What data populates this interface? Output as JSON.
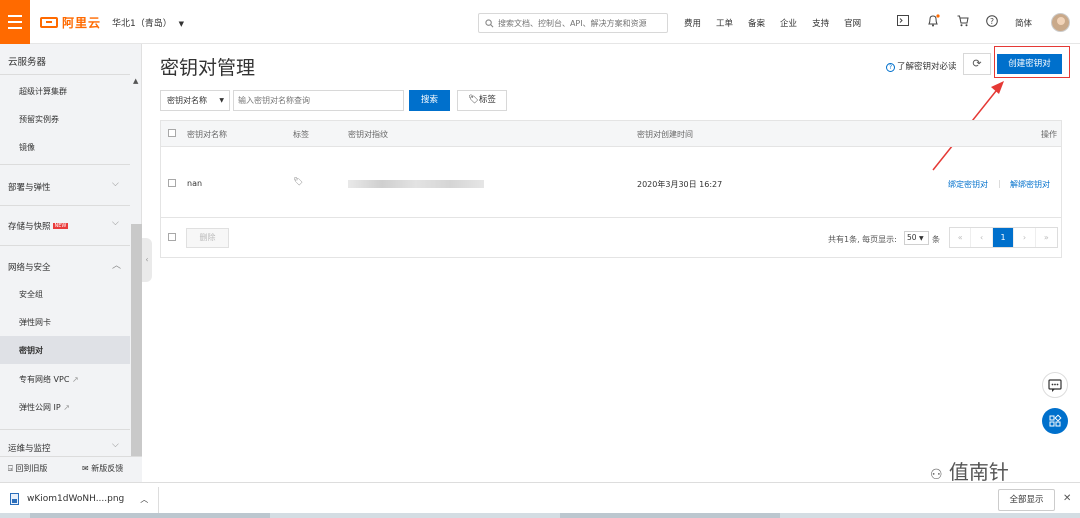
{
  "topbar": {
    "logo_text": "阿里云",
    "region": "华北1（青岛）",
    "search_placeholder": "搜索文档、控制台、API、解决方案和资源",
    "links": [
      "费用",
      "工单",
      "备案",
      "企业",
      "支持",
      "官网"
    ],
    "language": "简体",
    "brand_color": "#ff6a00"
  },
  "sidebar": {
    "title": "云服务器",
    "items_top": [
      "超级计算集群",
      "预留实例券",
      "镜像"
    ],
    "group_deploy": "部署与弹性",
    "group_storage": "存储与快照",
    "new_badge": "NEW",
    "group_network": "网络与安全",
    "network_items": [
      "安全组",
      "弹性网卡",
      "密钥对",
      "专有网络 VPC",
      "弹性公网 IP"
    ],
    "group_ops": "运维与监控",
    "footer_old": "回到旧版",
    "footer_feedback": "新版反馈"
  },
  "page": {
    "title": "密钥对管理",
    "help_link": "了解密钥对必读",
    "create_button": "创建密钥对",
    "accent_color": "#0070cc"
  },
  "filter": {
    "select_value": "密钥对名称",
    "input_placeholder": "输入密钥对名称查询",
    "search_button": "搜索",
    "tag_button": "标签"
  },
  "table": {
    "headers": [
      "密钥对名称",
      "标签",
      "密钥对指纹",
      "密钥对创建时间",
      "操作"
    ],
    "rows": [
      {
        "name": "nan",
        "created": "2020年3月30日 16:27",
        "action_bind": "绑定密钥对",
        "action_unbind": "解绑密钥对"
      }
    ],
    "delete_button": "删除",
    "page_info": "共有1条, 每页显示:",
    "page_size": "50",
    "page_unit": "条",
    "current_page": "1",
    "pager": [
      "«",
      "‹",
      "1",
      "›",
      "»"
    ]
  },
  "watermark": "值南针",
  "download_bar": {
    "file_name": "wKiom1dWoNH....png",
    "show_all": "全部显示"
  },
  "annotation_color": "#e53935"
}
